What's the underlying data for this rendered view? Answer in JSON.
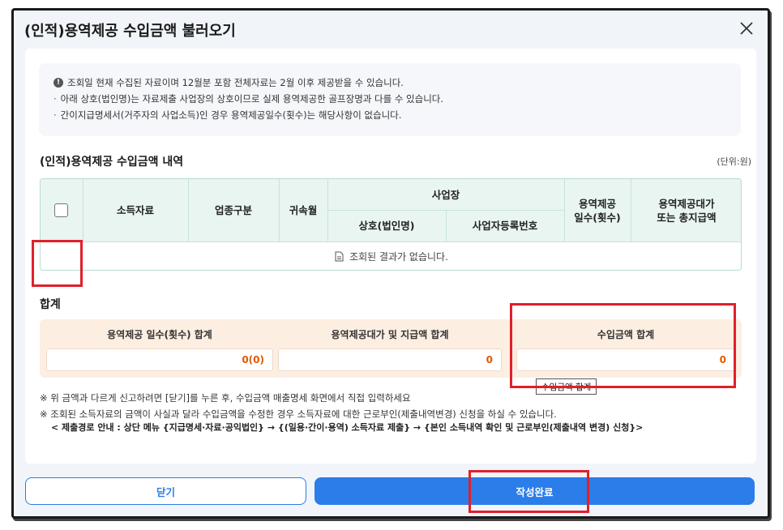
{
  "dialog": {
    "title": "(인적)용역제공 수입금액 불러오기"
  },
  "notice": {
    "lines": [
      "조회일 현재 수집된 자료이며 12월분 포함 전체자료는 2월 이후 제공받을 수 있습니다.",
      "아래 상호(법인명)는 자료제출 사업장의 상호이므로 실제 용역제공한 골프장명과 다를 수 있습니다.",
      "간이지급명세서(거주자의 사업소득)인 경우 용역제공일수(횟수)는 해당사항이 없습니다."
    ]
  },
  "table": {
    "title": "(인적)용역제공 수입금액 내역",
    "unit": "(단위:원)",
    "headers": {
      "income_type": "소득자료",
      "industry": "업종구분",
      "year_month": "귀속월",
      "workplace": "사업장",
      "company_name": "상호(법인명)",
      "biz_reg_no": "사업자등록번호",
      "service_days_line1": "용역제공",
      "service_days_line2": "일수(횟수)",
      "payment_line1": "용역제공대가",
      "payment_line2": "또는 총지급액"
    },
    "empty_message": "조회된 결과가 없습니다."
  },
  "summary": {
    "title": "합계",
    "days_label": "용역제공 일수(횟수) 합계",
    "days_value": "0(0)",
    "payment_label": "용역제공대가 및 지급액 합계",
    "payment_value": "0",
    "income_label": "수입금액 합계",
    "income_value": "0",
    "tooltip": "수입금액 합계"
  },
  "footnotes": [
    "※ 위 금액과 다르게 신고하려면 [닫기]를 누른 후, 수입금액 매출명세 화면에서 직접 입력하세요",
    "※ 조회된 소득자료의 금액이 사실과 달라 수입금액을 수정한 경우 소득자료에 대한 근로부인(제출내역변경) 신청을 하실 수 있습니다.",
    "< 제출경로 안내 : 상단 메뉴 {지급명세·자료·공익법인} → {(일용·간이·용역) 소득자료 제출} → {본인 소득내역 확인 및 근로부인(제출내역 변경) 신청}>"
  ],
  "buttons": {
    "close_label": "닫기",
    "complete_label": "작성완료"
  },
  "colors": {
    "primary": "#2b7de9",
    "highlight": "#e0202a",
    "value_text": "#e05a00",
    "table_header_bg": "#e9f5f1",
    "summary_bg": "#fdeee2"
  },
  "icons": {
    "close": "x-close-icon",
    "info": "info-circle-icon",
    "document": "document-icon",
    "checkbox": "checkbox-icon"
  }
}
